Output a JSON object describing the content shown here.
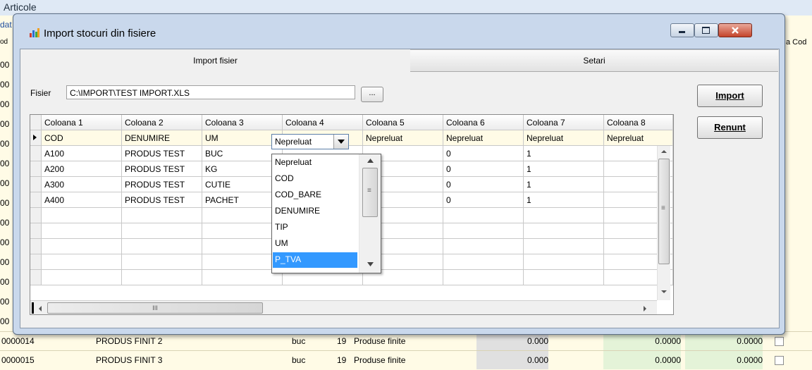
{
  "app": {
    "window_title": "Articole",
    "left_codes": [
      "dat",
      "od",
      "00",
      "00",
      "00",
      "00",
      "00",
      "00",
      "00",
      "00",
      "00",
      "00",
      "00",
      "00",
      "00",
      "00"
    ],
    "right_header": "a Cod",
    "rows": [
      {
        "code": "0000014",
        "name": "PRODUS FINIT 2",
        "um": "buc",
        "tva": "19",
        "type": "Produse finite",
        "qty": "0.000",
        "price1": "0.0000",
        "price2": "0.0000"
      },
      {
        "code": "0000015",
        "name": "PRODUS FINIT 3",
        "um": "buc",
        "tva": "19",
        "type": "Produse finite",
        "qty": "0.000",
        "price1": "0.0000",
        "price2": "0.0000"
      }
    ]
  },
  "dialog": {
    "title": "Import stocuri din fisiere",
    "tabs": [
      {
        "label": "Import fisier",
        "active": true
      },
      {
        "label": "Setari",
        "active": false
      }
    ],
    "file_label": "Fisier",
    "file_path": "C:\\IMPORT\\TEST IMPORT.XLS",
    "browse_label": "...",
    "import_label": "Import",
    "cancel_label": "Renunt",
    "grid": {
      "headers": [
        "Coloana 1",
        "Coloana 2",
        "Coloana 3",
        "Coloana 4",
        "Coloana 5",
        "Coloana 6",
        "Coloana 7",
        "Coloana 8"
      ],
      "mapping": [
        "COD",
        "DENUMIRE",
        "UM",
        "Nepreluat",
        "Nepreluat",
        "Nepreluat",
        "Nepreluat",
        "Nepreluat"
      ],
      "rows": [
        [
          "A100",
          "PRODUS TEST",
          "BUC",
          "",
          "",
          "0",
          "1",
          ""
        ],
        [
          "A200",
          "PRODUS TEST",
          "KG",
          "",
          "",
          "0",
          "1",
          ""
        ],
        [
          "A300",
          "PRODUS TEST",
          "CUTIE",
          "",
          "",
          "0",
          "1",
          ""
        ],
        [
          "A400",
          "PRODUS TEST",
          "PACHET",
          "",
          "",
          "0",
          "1",
          ""
        ]
      ],
      "hscroll_glyph": "III"
    },
    "dropdown": {
      "selected_value": "Nepreluat",
      "options": [
        "Nepreluat",
        "COD",
        "COD_BARE",
        "DENUMIRE",
        "TIP",
        "UM",
        "P_TVA"
      ],
      "highlighted": "P_TVA",
      "scroll_glyph": "≡"
    }
  }
}
